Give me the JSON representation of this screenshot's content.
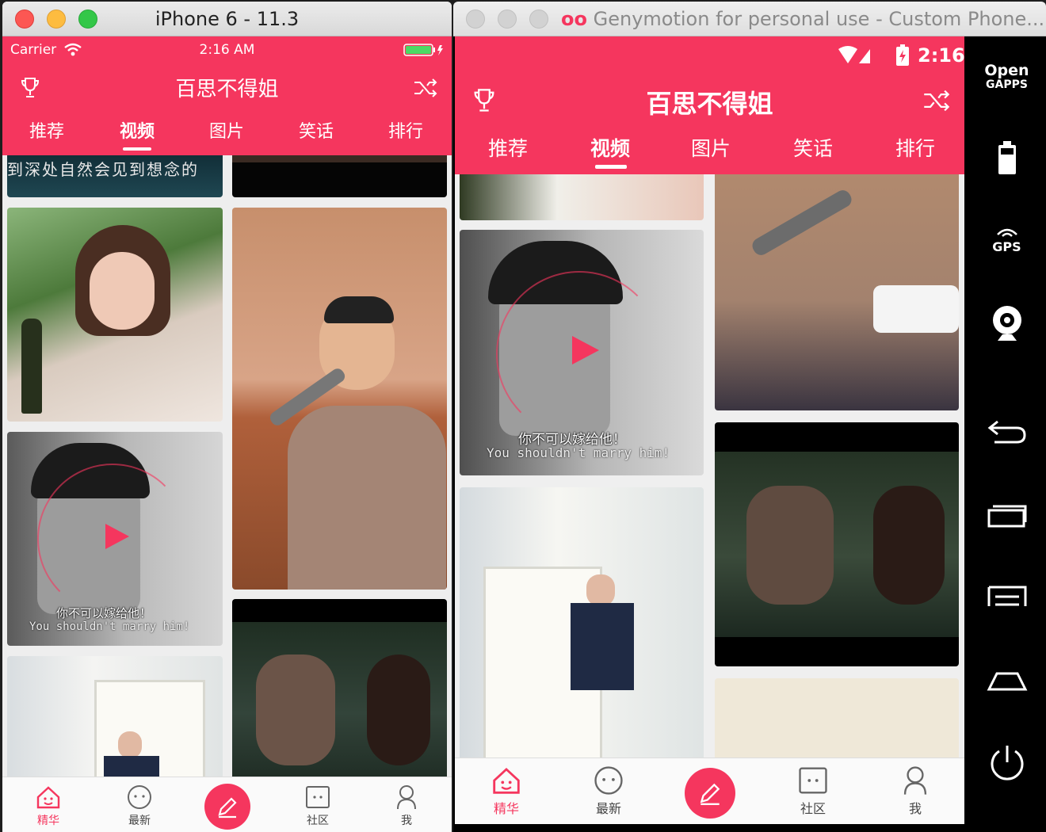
{
  "ios": {
    "window_title": "iPhone 6 - 11.3",
    "status": {
      "carrier": "Carrier",
      "time": "2:16 AM"
    },
    "app_title": "百思不得姐",
    "tabs": [
      "推荐",
      "视频",
      "图片",
      "笑话",
      "排行"
    ],
    "active_tab": "视频",
    "feed": {
      "top_caption": "到深处自然会见到想念的",
      "subtitle_cn": "你不可以嫁给他！",
      "subtitle_en": "You shouldn't marry him!"
    },
    "tabbar": {
      "items": [
        "精华",
        "最新",
        "社区",
        "我"
      ],
      "active": "精华"
    }
  },
  "genymotion": {
    "window_title": "Genymotion for personal use - Custom Phone...",
    "status": {
      "time": "2:16"
    },
    "app_title": "百思不得姐",
    "tabs": [
      "推荐",
      "视频",
      "图片",
      "笑话",
      "排行"
    ],
    "active_tab": "视频",
    "feed": {
      "subtitle_cn": "你不可以嫁给他！",
      "subtitle_en": "You shouldn't marry him!"
    },
    "tabbar": {
      "items": [
        "精华",
        "最新",
        "社区",
        "我"
      ],
      "active": "精华"
    },
    "sidebar": {
      "open_gapps_line1": "Open",
      "open_gapps_line2": "GAPPS",
      "gps": "GPS"
    }
  },
  "colors": {
    "accent": "#f5365e",
    "feed_bg": "#eeeeee"
  },
  "icons": [
    "wifi-icon",
    "battery-icon",
    "trophy-icon",
    "shuffle-icon",
    "house-icon",
    "smiley-icon",
    "pencil-icon",
    "community-icon",
    "person-icon",
    "signal-icon",
    "webcam-icon",
    "back-icon",
    "recent-apps-icon",
    "menu-icon",
    "home-icon",
    "power-icon"
  ]
}
